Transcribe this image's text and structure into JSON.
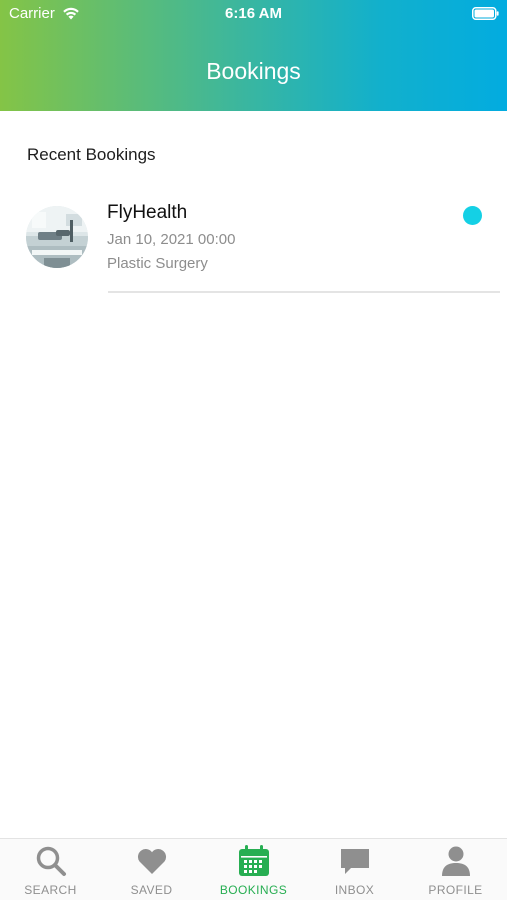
{
  "status_bar": {
    "carrier": "Carrier",
    "time": "6:16 AM"
  },
  "header": {
    "title": "Bookings",
    "gradient_colors": [
      "#84c446",
      "#02ace0"
    ]
  },
  "recent": {
    "section_title": "Recent Bookings",
    "items": [
      {
        "name": "FlyHealth",
        "datetime": "Jan 10, 2021 00:00",
        "category": "Plastic Surgery",
        "status_color": "#14d0e5",
        "avatar_icon": "clinic-photo-avatar"
      }
    ]
  },
  "tabbar": {
    "active_color": "#27ae52",
    "inactive_color": "#8f8f8f",
    "tabs": [
      {
        "label": "SEARCH",
        "icon": "search-icon",
        "active": false
      },
      {
        "label": "SAVED",
        "icon": "heart-icon",
        "active": false
      },
      {
        "label": "BOOKINGS",
        "icon": "calendar-icon",
        "active": true
      },
      {
        "label": "INBOX",
        "icon": "chat-bubble-icon",
        "active": false
      },
      {
        "label": "PROFILE",
        "icon": "person-icon",
        "active": false
      }
    ]
  }
}
